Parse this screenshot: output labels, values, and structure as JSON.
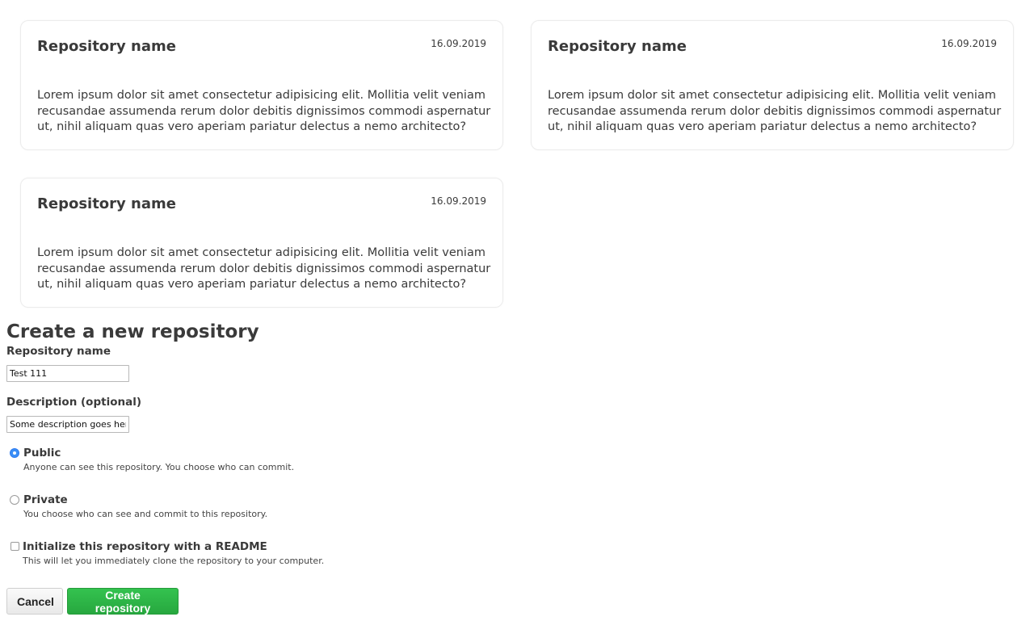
{
  "repositories": [
    {
      "name": "Repository name",
      "date": "16.09.2019",
      "description": "Lorem ipsum dolor sit amet consectetur adipisicing elit. Mollitia velit veniam recusandae assumenda rerum dolor debitis dignissimos commodi aspernatur ut, nihil aliquam quas vero aperiam pariatur delectus a nemo architecto?"
    },
    {
      "name": "Repository name",
      "date": "16.09.2019",
      "description": "Lorem ipsum dolor sit amet consectetur adipisicing elit. Mollitia velit veniam recusandae assumenda rerum dolor debitis dignissimos commodi aspernatur ut, nihil aliquam quas vero aperiam pariatur delectus a nemo architecto?"
    },
    {
      "name": "Repository name",
      "date": "16.09.2019",
      "description": "Lorem ipsum dolor sit amet consectetur adipisicing elit. Mollitia velit veniam recusandae assumenda rerum dolor debitis dignissimos commodi aspernatur ut, nihil aliquam quas vero aperiam pariatur delectus a nemo architecto?"
    }
  ],
  "form": {
    "title": "Create a new repository",
    "name_label": "Repository name",
    "name_value": "Test 111",
    "description_label": "Description (optional)",
    "description_value": "Some description goes here",
    "visibility": {
      "selected": "public",
      "public_label": "Public",
      "public_help": "Anyone can see this repository. You choose who can commit.",
      "private_label": "Private",
      "private_help": "You choose who can see and commit to this repository."
    },
    "readme": {
      "checked": false,
      "label": "Initialize this repository with a README",
      "help": "This will let you immediately clone the repository to your computer."
    },
    "cancel_label": "Cancel",
    "create_label": "Create repository"
  },
  "colors": {
    "accent_blue": "#3a8ef6",
    "create_green": "#2db446",
    "text": "#3a3a3a"
  }
}
